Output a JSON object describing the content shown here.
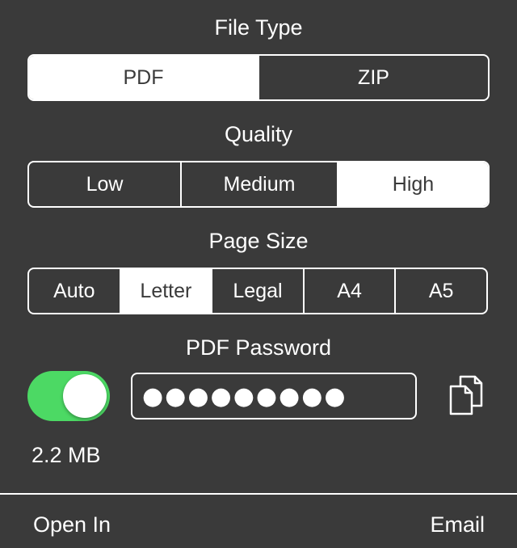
{
  "file_type": {
    "title": "File Type",
    "options": [
      "PDF",
      "ZIP"
    ],
    "selected": "PDF"
  },
  "quality": {
    "title": "Quality",
    "options": [
      "Low",
      "Medium",
      "High"
    ],
    "selected": "High"
  },
  "page_size": {
    "title": "Page Size",
    "options": [
      "Auto",
      "Letter",
      "Legal",
      "A4",
      "A5"
    ],
    "selected": "Letter"
  },
  "pdf_password": {
    "title": "PDF Password",
    "enabled": true,
    "value_masked": "●●●●●●●●●"
  },
  "file_size": "2.2 MB",
  "footer": {
    "open_in": "Open In",
    "email": "Email"
  },
  "colors": {
    "background": "#3a3a3a",
    "toggle_on": "#4cd964",
    "foreground": "#ffffff"
  },
  "icons": {
    "copy": "copy-icon"
  }
}
